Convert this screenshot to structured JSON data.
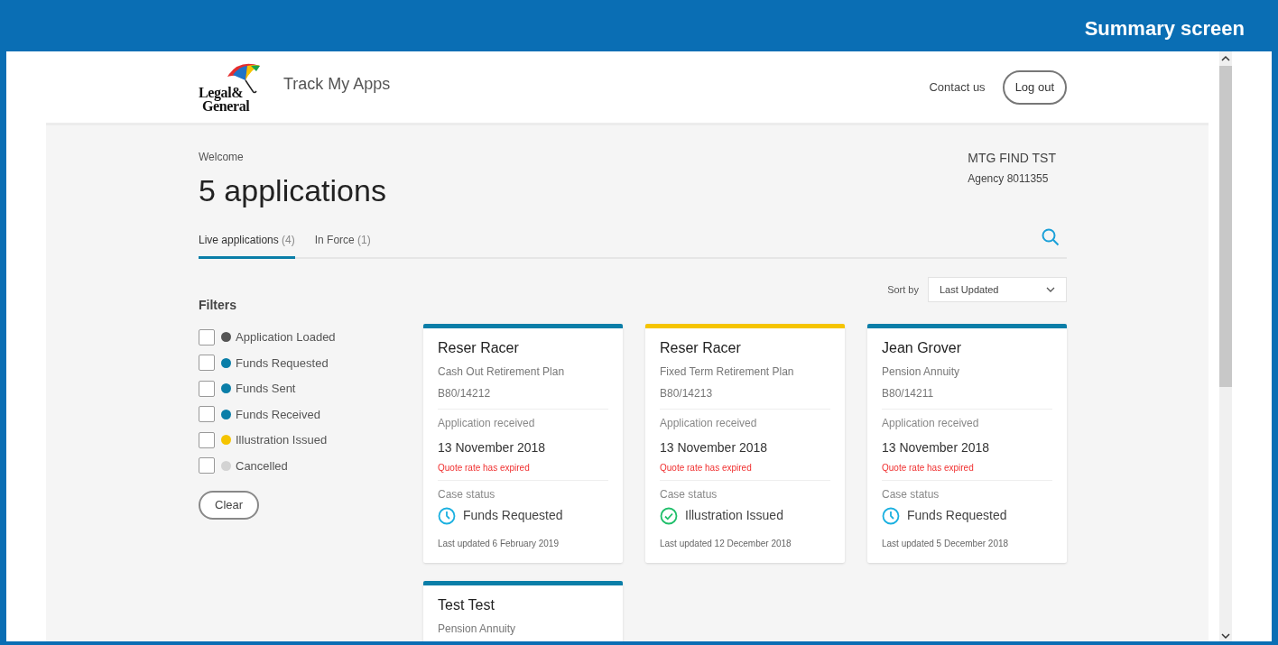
{
  "banner": {
    "title": "Summary screen"
  },
  "header": {
    "logo": {
      "line1": "Legal&",
      "line2": "General"
    },
    "app_name": "Track My Apps",
    "contact_link": "Contact us",
    "logout_button": "Log out"
  },
  "welcome": "Welcome",
  "heading": "5 applications",
  "account": {
    "name": "MTG FIND TST",
    "agency": "Agency 8011355"
  },
  "tabs": [
    {
      "label": "Live applications",
      "count": "(4)",
      "selected": true
    },
    {
      "label": "In Force",
      "count": "(1)",
      "selected": false
    }
  ],
  "sort": {
    "label": "Sort by",
    "value": "Last Updated"
  },
  "filters": {
    "title": "Filters",
    "items": [
      {
        "label": "Application Loaded",
        "color": "#555555",
        "checked": false
      },
      {
        "label": "Funds Requested",
        "color": "#0a7ea8",
        "checked": false
      },
      {
        "label": "Funds Sent",
        "color": "#0a7ea8",
        "checked": false
      },
      {
        "label": "Funds Received",
        "color": "#0a7ea8",
        "checked": false
      },
      {
        "label": "Illustration Issued",
        "color": "#f5c400",
        "checked": false
      },
      {
        "label": "Cancelled",
        "color": "#d3d3d3",
        "checked": false
      }
    ],
    "clear_button": "Clear"
  },
  "cards": [
    {
      "color": "#0a7ea8",
      "name": "Reser Racer",
      "plan": "Cash Out Retirement Plan",
      "reference": "B80/14212",
      "received_label": "Application received",
      "received_date": "13 November 2018",
      "warning": "Quote rate has expired",
      "status_label": "Case status",
      "status": {
        "kind": "clock",
        "text": "Funds Requested"
      },
      "last_updated": "Last updated 6 February 2019"
    },
    {
      "color": "#f5c400",
      "name": "Reser Racer",
      "plan": "Fixed Term Retirement Plan",
      "reference": "B80/14213",
      "received_label": "Application received",
      "received_date": "13 November 2018",
      "warning": "Quote rate has expired",
      "status_label": "Case status",
      "status": {
        "kind": "check",
        "text": "Illustration Issued"
      },
      "last_updated": "Last updated 12 December 2018"
    },
    {
      "color": "#0a7ea8",
      "name": "Jean Grover",
      "plan": "Pension Annuity",
      "reference": "B80/14211",
      "received_label": "Application received",
      "received_date": "13 November 2018",
      "warning": "Quote rate has expired",
      "status_label": "Case status",
      "status": {
        "kind": "clock",
        "text": "Funds Requested"
      },
      "last_updated": "Last updated 5 December 2018"
    },
    {
      "color": "#0a7ea8",
      "name": "Test Test",
      "plan": "Pension Annuity"
    }
  ]
}
